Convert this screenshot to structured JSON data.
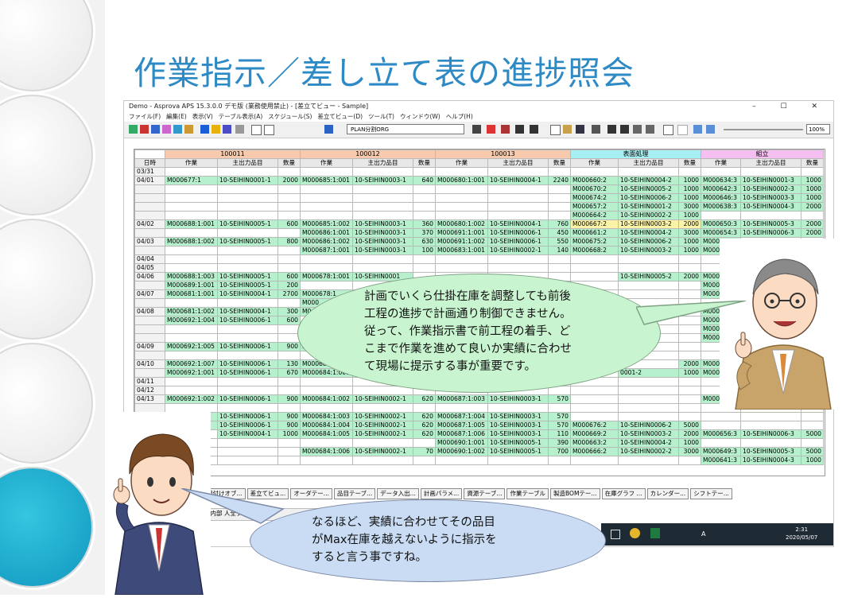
{
  "slide": {
    "title": "作業指示／差し立て表の進捗照会"
  },
  "window": {
    "title": "Demo - Asprova APS 15.3.0.0 デモ版 (業務使用禁止) - [差立てビュー - Sample]",
    "controls": "–  ☐  ✕",
    "menus": [
      "ファイル(F)",
      "編集(E)",
      "表示(V)",
      "テーブル表示(A)",
      "スケジュール(S)",
      "差立てビュー(D)",
      "ツール(T)",
      "ウィンドウ(W)",
      "ヘルプ(H)"
    ],
    "combo_value": "PLAN分割ORG",
    "zoom": "100%"
  },
  "grid": {
    "groups": [
      "100011",
      "100012",
      "100013",
      "表面処理",
      "組立"
    ],
    "col_headers": [
      "日時",
      "作業",
      "主出力品目",
      "数量",
      "作業",
      "主出力品目",
      "数量",
      "作業",
      "主出力品目",
      "数量",
      "作業",
      "主出力品目",
      "数量",
      "作業",
      "主出力品目",
      "数量"
    ],
    "rows": [
      [
        "03/31",
        "",
        "",
        "",
        "",
        "",
        "",
        "",
        "",
        "",
        "",
        "",
        "",
        "",
        "",
        ""
      ],
      [
        "04/01",
        "M000677:1",
        "10-SEIHIN0001-1",
        "2000",
        "M000685:1:001",
        "10-SEIHIN0003-1",
        "640",
        "M000680:1:001",
        "10-SEIHIN0004-1",
        "2240",
        "M000660:2",
        "10-SEIHIN0004-2",
        "1000",
        "M000634:3",
        "10-SEIHIN0001-3",
        "1000"
      ],
      [
        "",
        "",
        "",
        "",
        "",
        "",
        "",
        "",
        "",
        "",
        "M000670:2",
        "10-SEIHIN0005-2",
        "1000",
        "M000642:3",
        "10-SEIHIN0002-3",
        "1000"
      ],
      [
        "",
        "",
        "",
        "",
        "",
        "",
        "",
        "",
        "",
        "",
        "M000674:2",
        "10-SEIHIN0006-2",
        "1000",
        "M000646:3",
        "10-SEIHIN0003-3",
        "1000"
      ],
      [
        "",
        "",
        "",
        "",
        "",
        "",
        "",
        "",
        "",
        "",
        "M000657:2",
        "10-SEIHIN0001-2",
        "3000",
        "M000638:3",
        "10-SEIHIN0004-3",
        "2000"
      ],
      [
        "",
        "",
        "",
        "",
        "",
        "",
        "",
        "",
        "",
        "",
        "M000664:2",
        "10-SEIHIN0002-2",
        "1000",
        "",
        "",
        ""
      ],
      [
        "04/02",
        "M000688:1:001",
        "10-SEIHIN0005-1",
        "600",
        "M000685:1:002",
        "10-SEIHIN0003-1",
        "360",
        "M000680:1:002",
        "10-SEIHIN0004-1",
        "760",
        "M000667:2",
        "10-SEIHIN0003-2",
        "2000",
        "M000650:3",
        "10-SEIHIN0005-3",
        "2000"
      ],
      [
        "",
        "",
        "",
        "",
        "M000686:1:001",
        "10-SEIHIN0003-1",
        "370",
        "M000691:1:001",
        "10-SEIHIN0006-1",
        "450",
        "M000661:2",
        "10-SEIHIN0004-2",
        "3000",
        "M000654:3",
        "10-SEIHIN0006-3",
        "2000"
      ],
      [
        "04/03",
        "M000688:1:002",
        "10-SEIHIN0005-1",
        "800",
        "M000686:1:002",
        "10-SEIHIN0003-1",
        "630",
        "M000691:1:002",
        "10-SEIHIN0006-1",
        "550",
        "M000675:2",
        "10-SEIHIN0006-2",
        "1000",
        "M000635:3",
        "",
        ""
      ],
      [
        "",
        "",
        "",
        "",
        "M000687:1:001",
        "10-SEIHIN0003-1",
        "100",
        "M000683:1:001",
        "10-SEIHIN0002-1",
        "140",
        "M000668:2",
        "10-SEIHIN0003-2",
        "1000",
        "M000643:3",
        "",
        ""
      ],
      [
        "04/04",
        "",
        "",
        "",
        "",
        "",
        "",
        "",
        "",
        "",
        "",
        "",
        "",
        "",
        "",
        ""
      ],
      [
        "04/05",
        "",
        "",
        "",
        "",
        "",
        "",
        "",
        "",
        "",
        "",
        "",
        "",
        "",
        "",
        ""
      ],
      [
        "04/06",
        "M000688:1:003",
        "10-SEIHIN0005-1",
        "600",
        "M000678:1:001",
        "10-SEIHIN0001",
        "",
        "",
        "",
        "",
        "",
        "10-SEIHIN0005-2",
        "2000",
        "M000647:3",
        "",
        ""
      ],
      [
        "",
        "M000689:1:001",
        "10-SEIHIN0005-1",
        "200",
        "",
        "",
        "",
        "",
        "",
        "",
        "",
        "",
        "",
        "M000639:3",
        "",
        ""
      ],
      [
        "04/07",
        "M000681:1:001",
        "10-SEIHIN0004-1",
        "2700",
        "M000678:1",
        "",
        "",
        "",
        "",
        "",
        "",
        "",
        "",
        "M000651:3",
        "",
        ""
      ],
      [
        "",
        "",
        "",
        "",
        "M000",
        "",
        "",
        "",
        "",
        "",
        "",
        "",
        "",
        "",
        "",
        ""
      ],
      [
        "04/08",
        "M000681:1:002",
        "10-SEIHIN0004-1",
        "300",
        "M0",
        "",
        "",
        "",
        "",
        "",
        "",
        "",
        "",
        "M000655:3",
        "",
        ""
      ],
      [
        "",
        "M000692:1:004",
        "10-SEIHIN0006-1",
        "600",
        "",
        "",
        "",
        "",
        "",
        "",
        "",
        "",
        "",
        "M000636:3",
        "",
        ""
      ],
      [
        "",
        "",
        "",
        "",
        "",
        "",
        "",
        "",
        "",
        "",
        "",
        "",
        "",
        "M000648:3",
        "",
        ""
      ],
      [
        "",
        "",
        "",
        "",
        "",
        "",
        "",
        "",
        "",
        "",
        "",
        "",
        "",
        "M000640:3",
        "",
        ""
      ],
      [
        "04/09",
        "M000692:1:005",
        "10-SEIHIN0006-1",
        "900",
        "M",
        "",
        "",
        "",
        "",
        "",
        "",
        "",
        "",
        "",
        "",
        ""
      ],
      [
        "",
        "",
        "",
        "",
        "",
        "",
        "",
        "",
        "",
        "",
        "",
        "",
        "",
        "",
        "",
        ""
      ],
      [
        "04/10",
        "M000692:1:007",
        "10-SEIHIN0006-1",
        "130",
        "M000689:1",
        "",
        "",
        "",
        "",
        "",
        "",
        "",
        "2000",
        "M000644:3",
        "",
        ""
      ],
      [
        "",
        "M000692:1:001",
        "10-SEIHIN0006-1",
        "670",
        "M000684:1:001",
        "10",
        "",
        "",
        "",
        "",
        "",
        "0001-2",
        "1000",
        "M000652:3",
        "",
        ""
      ],
      [
        "04/11",
        "",
        "",
        "",
        "",
        "",
        "",
        "",
        "",
        "",
        "",
        "",
        "",
        "",
        "",
        ""
      ],
      [
        "04/12",
        "",
        "",
        "",
        "",
        "",
        "",
        "",
        "",
        "",
        "",
        "",
        "",
        "",
        "",
        ""
      ],
      [
        "04/13",
        "M000692:1:002",
        "10-SEIHIN0006-1",
        "900",
        "M000684:1:002",
        "10-SEIHIN0002-1",
        "620",
        "M000687:1:003",
        "10-SEIHIN0003-1",
        "570",
        "",
        "",
        "",
        "M000637:3",
        "",
        ""
      ],
      [
        "",
        "",
        "",
        "",
        "",
        "",
        "",
        "",
        "",
        "",
        "",
        "",
        "",
        "",
        "",
        ""
      ],
      [
        "",
        "3",
        "10-SEIHIN0006-1",
        "900",
        "M000684:1:003",
        "10-SEIHIN0002-1",
        "620",
        "M000687:1:004",
        "10-SEIHIN0003-1",
        "570",
        "",
        "",
        "",
        "",
        "",
        ""
      ],
      [
        "",
        "6",
        "10-SEIHIN0006-1",
        "900",
        "M000684:1:004",
        "10-SEIHIN0002-1",
        "620",
        "M000687:1:005",
        "10-SEIHIN0003-1",
        "570",
        "M000676:2",
        "10-SEIHIN0006-2",
        "5000",
        "",
        "",
        ""
      ],
      [
        "",
        "",
        "10-SEIHIN0004-1",
        "1000",
        "M000684:1:005",
        "10-SEIHIN0002-1",
        "620",
        "M000687:1:006",
        "10-SEIHIN0003-1",
        "110",
        "M000669:2",
        "10-SEIHIN0003-2",
        "2000",
        "M000656:3",
        "10-SEIHIN0006-3",
        "5000"
      ],
      [
        "",
        "",
        "",
        "",
        "",
        "",
        "",
        "M000690:1:001",
        "10-SEIHIN0005-1",
        "390",
        "M000663:2",
        "10-SEIHIN0004-2",
        "1000",
        "",
        "",
        ""
      ],
      [
        "",
        "",
        "",
        "",
        "M000684:1:006",
        "10-SEIHIN0002-1",
        "70",
        "M000690:1:002",
        "10-SEIHIN0005-1",
        "700",
        "M000666:2",
        "10-SEIHIN0002-2",
        "3000",
        "M000649:3",
        "10-SEIHIN0005-3",
        "5000"
      ],
      [
        "",
        "",
        "",
        "",
        "",
        "",
        "",
        "",
        "",
        "",
        "",
        "",
        "",
        "M000641:3",
        "10-SEIHIN0004-3",
        "1000"
      ]
    ]
  },
  "tabs": [
    "組付けオブ...",
    "差立てビュ...",
    "オーダテー...",
    "品目テーブ...",
    "データ入出...",
    "計画パラメ...",
    "資源テーブ...",
    "作業テーブル",
    "製造BOMテー...",
    "在庫グラフ ...",
    "カレンダー...",
    "シフトテー..."
  ],
  "taskbar": {
    "time": "2:31",
    "date": "2020/05/07",
    "ime": "A"
  },
  "callouts": {
    "teacher": "計画でいくら仕掛在庫を調整しても前後工程の進捗で計画通り制御できません。従って、作業指示書で前工程の着手、どこまで作業を進めて良いか実績に合わせて現場に提示する事が重要です。",
    "teacher_lines": [
      "計画でいくら仕掛在庫を調整しても前後",
      "工程の進捗で計画通り制御できません。",
      "従って、作業指示書で前工程の着手、ど",
      "こまで作業を進めて良いか実績に合わせ",
      "て現場に提示する事が重要です。"
    ],
    "student_lines": [
      "なるほど、実績に合わせてその品目",
      "がMax在庫を越えないように指示を",
      "すると言う事ですね。"
    ]
  },
  "bottom_fragments": {
    "left": "入内部 人全プロパ",
    "left2": "索"
  }
}
